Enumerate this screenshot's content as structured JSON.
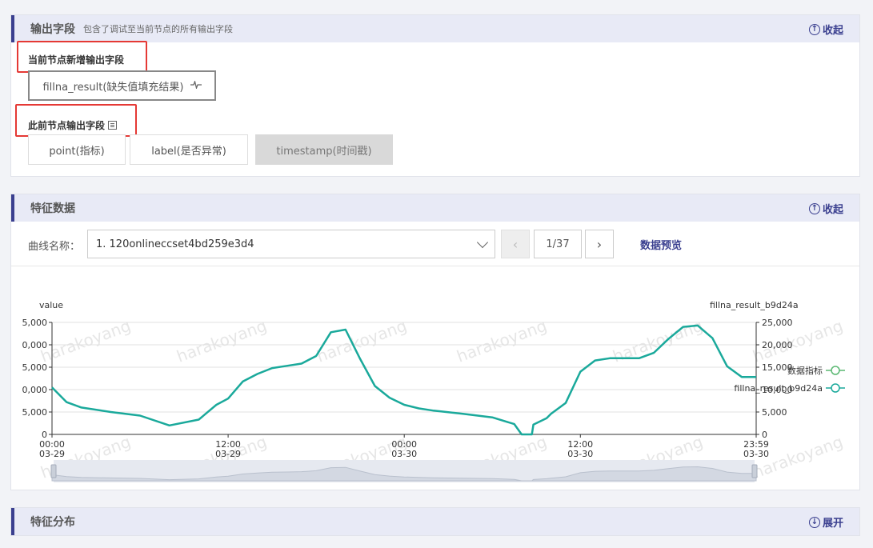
{
  "output_panel": {
    "title": "输出字段",
    "subtitle": "包含了调试至当前节点的所有输出字段",
    "collapse_label": "收起",
    "new_fields_label": "当前节点新增输出字段",
    "new_fields": [
      {
        "label": "fillna_result(缺失值填充结果)",
        "icon": "pulse-icon"
      }
    ],
    "prev_fields_label": "此前节点输出字段",
    "prev_fields": [
      {
        "label": "point(指标)",
        "disabled": false
      },
      {
        "label": "label(是否异常)",
        "disabled": false
      },
      {
        "label": "timestamp(时间戳)",
        "disabled": true
      }
    ]
  },
  "feature_panel": {
    "title": "特征数据",
    "collapse_label": "收起",
    "curve_label": "曲线名称：",
    "curve_value": "1. 120onlineccset4bd259e3d4",
    "page": "1/37",
    "preview_label": "数据预览"
  },
  "dist_panel": {
    "title": "特征分布",
    "expand_label": "展开"
  },
  "colors": {
    "accent": "#3a3f8f",
    "series_primary": "#1aa99b",
    "series_secondary": "#5ab872",
    "highlight": "#e53935"
  },
  "chart_data": {
    "type": "line",
    "left_axis_label": "value",
    "right_axis_label": "fillna_result_b9d24a",
    "left_ticks": [
      "0",
      "5,000",
      "0,000",
      "5,000",
      "0,000",
      "5,000"
    ],
    "right_ticks": [
      "0",
      "5,000",
      "10,000",
      "15,000",
      "20,000",
      "25,000"
    ],
    "ylim": [
      0,
      25000
    ],
    "x_ticks": [
      {
        "time": "00:00",
        "date": "03-29"
      },
      {
        "time": "12:00",
        "date": "03-29"
      },
      {
        "time": "00:00",
        "date": "03-30"
      },
      {
        "time": "12:00",
        "date": "03-30"
      },
      {
        "time": "23:59",
        "date": "03-30"
      }
    ],
    "legend": [
      {
        "name": "数据指标",
        "color": "#5ab872"
      },
      {
        "name": "fillna_result_b9d24a",
        "color": "#1aa99b"
      }
    ],
    "series": [
      {
        "name": "fillna_result_b9d24a",
        "x_hours": [
          0,
          1,
          2,
          4,
          6,
          8,
          10,
          11.2,
          12,
          13,
          14,
          15,
          16,
          17,
          18,
          19,
          20,
          21,
          22,
          23,
          24,
          25,
          26,
          28,
          30,
          31.5,
          32,
          32.7,
          32.8,
          33.7,
          34,
          35,
          36,
          37,
          38,
          39,
          40,
          41,
          42,
          43,
          44,
          45,
          46,
          47,
          47.98
        ],
        "values": [
          10500,
          7200,
          6000,
          5000,
          4200,
          2000,
          3300,
          6600,
          8000,
          11800,
          13500,
          14800,
          15300,
          15800,
          17500,
          22800,
          23400,
          16800,
          10800,
          8200,
          6600,
          5800,
          5300,
          4600,
          3800,
          2300,
          0,
          0,
          2200,
          3600,
          4600,
          7000,
          14000,
          16500,
          17000,
          17000,
          17000,
          18200,
          21300,
          24000,
          24300,
          21500,
          15200,
          12800,
          12800
        ]
      }
    ]
  },
  "watermark": "harakoyang"
}
